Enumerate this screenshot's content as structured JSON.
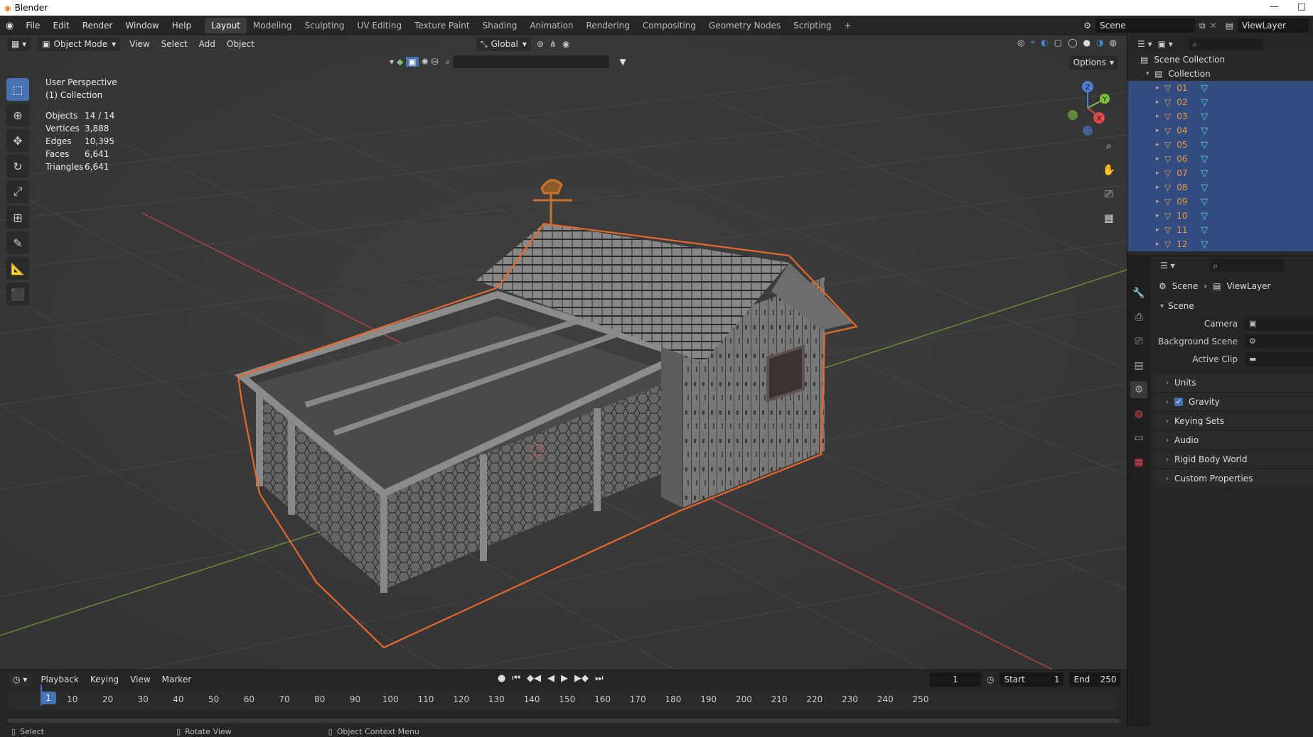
{
  "window": {
    "title": "Blender",
    "controls": [
      "—",
      "□"
    ]
  },
  "menu": {
    "items": [
      "File",
      "Edit",
      "Render",
      "Window",
      "Help"
    ]
  },
  "workspaces": {
    "tabs": [
      "Layout",
      "Modeling",
      "Sculpting",
      "UV Editing",
      "Texture Paint",
      "Shading",
      "Animation",
      "Rendering",
      "Compositing",
      "Geometry Nodes",
      "Scripting"
    ],
    "active": "Layout",
    "add": "+"
  },
  "topright": {
    "scene": "Scene",
    "view_layer": "ViewLayer"
  },
  "viewport": {
    "mode": "Object Mode",
    "menus": [
      "View",
      "Select",
      "Add",
      "Object"
    ],
    "orientation": "Global",
    "options": "Options",
    "perspective": "User Perspective",
    "collection": "(1) Collection",
    "stats": [
      {
        "label": "Objects",
        "value": "14 / 14"
      },
      {
        "label": "Vertices",
        "value": "3,888"
      },
      {
        "label": "Edges",
        "value": "10,395"
      },
      {
        "label": "Faces",
        "value": "6,641"
      },
      {
        "label": "Triangles",
        "value": "6,641"
      }
    ],
    "gizmo": {
      "z": "Z",
      "y": "Y",
      "x": "X"
    }
  },
  "timeline": {
    "menus": [
      "Playback",
      "Keying",
      "View",
      "Marker"
    ],
    "current_frame": "1",
    "start_label": "Start",
    "start": "1",
    "end_label": "End",
    "end": "250",
    "ticks": [
      "1",
      "10",
      "20",
      "30",
      "40",
      "50",
      "60",
      "70",
      "80",
      "90",
      "100",
      "110",
      "120",
      "130",
      "140",
      "150",
      "160",
      "170",
      "180",
      "190",
      "200",
      "210",
      "220",
      "230",
      "240",
      "250"
    ],
    "cursor": "1"
  },
  "status": {
    "items": [
      "Select",
      "Rotate View",
      "Object Context Menu"
    ]
  },
  "outliner": {
    "root": "Scene Collection",
    "collection": "Collection",
    "objects": [
      "01",
      "02",
      "03",
      "04",
      "05",
      "06",
      "07",
      "08",
      "09",
      "10",
      "11",
      "12"
    ]
  },
  "properties": {
    "breadcrumb": [
      "Scene",
      "ViewLayer"
    ],
    "scene_panel": "Scene",
    "fields": [
      {
        "label": "Camera"
      },
      {
        "label": "Background Scene"
      },
      {
        "label": "Active Clip"
      }
    ],
    "subpanels": [
      "Units",
      "Gravity",
      "Keying Sets",
      "Audio",
      "Rigid Body World",
      "Custom Properties"
    ],
    "gravity_checked": true
  },
  "colors": {
    "accent": "#4772b3",
    "selection": "#e8682c",
    "outliner_sel": "#334d80"
  }
}
